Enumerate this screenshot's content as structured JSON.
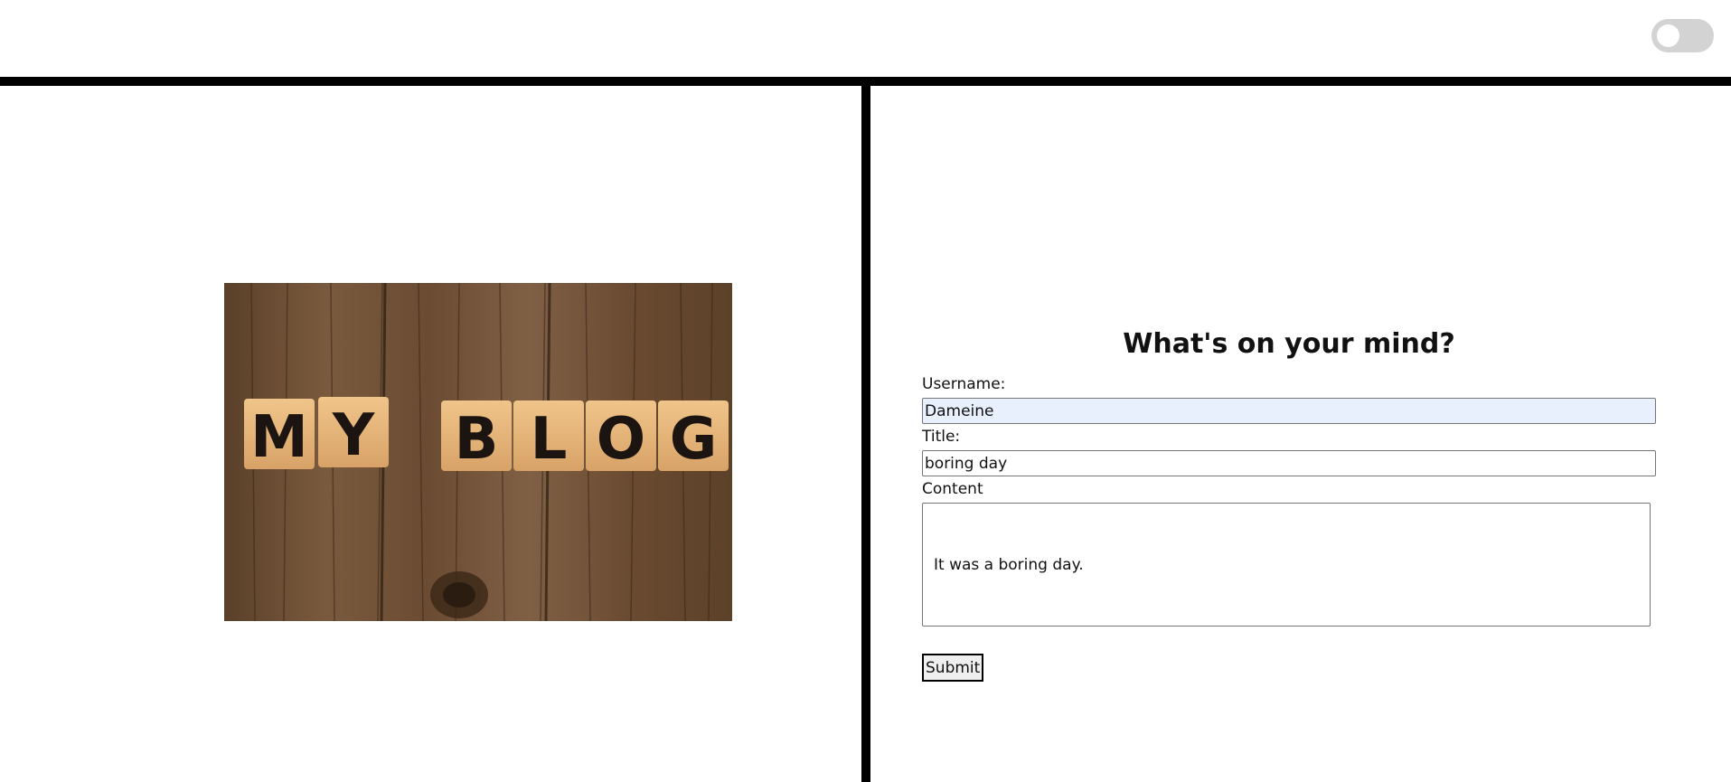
{
  "header": {
    "theme_toggle": {
      "state": "off"
    }
  },
  "hero": {
    "image_text": "MY BLOG"
  },
  "form": {
    "title": "What's on your mind?",
    "username_label": "Username:",
    "username_value": "Dameine",
    "title_label": "Title:",
    "title_value": "boring day",
    "content_label": "Content",
    "content_value": "It was a boring day.",
    "submit_label": "Submit"
  },
  "colors": {
    "divider": "#000000",
    "toggle_track": "#d3d3d3",
    "autofill_bg": "#e8f0fe"
  }
}
